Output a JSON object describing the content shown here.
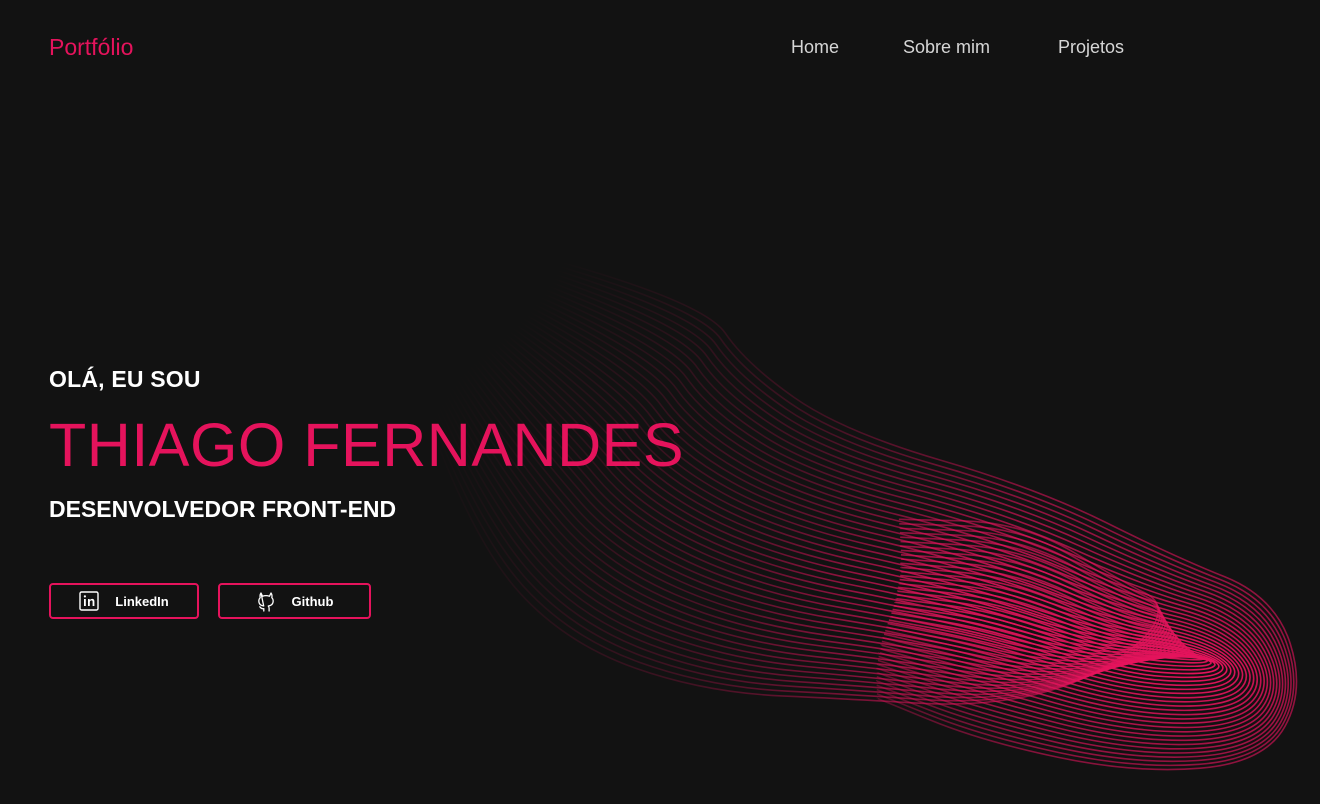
{
  "header": {
    "logo": "Portfólio",
    "nav": [
      {
        "label": "Home"
      },
      {
        "label": "Sobre mim"
      },
      {
        "label": "Projetos"
      }
    ]
  },
  "hero": {
    "greeting": "OLÁ, EU SOU",
    "name": "THIAGO FERNANDES",
    "role": "DESENVOLVEDOR FRONT-END",
    "buttons": {
      "linkedin": {
        "label": "LinkedIn",
        "icon": "linkedin-icon"
      },
      "github": {
        "label": "Github",
        "icon": "github-icon"
      }
    }
  },
  "colors": {
    "background": "#121212",
    "accent": "#e5135c",
    "text": "#ffffff",
    "nav_text": "#d6d6d6"
  }
}
